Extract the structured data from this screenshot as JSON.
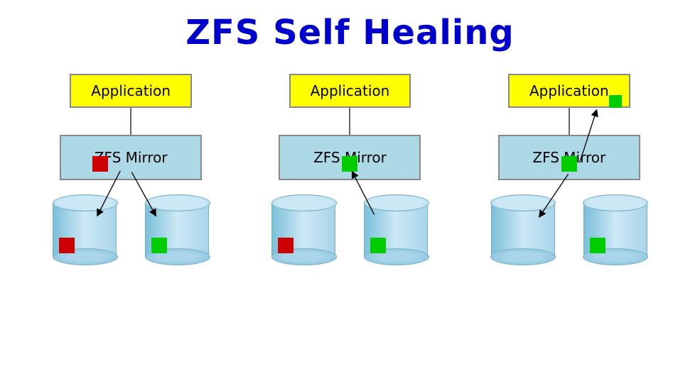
{
  "title": "ZFS Self Healing",
  "diagrams": [
    {
      "id": "diagram-1",
      "app_label": "Application",
      "mirror_label": "ZFS Mirror",
      "mirror_indicator": "red",
      "cylinders": [
        {
          "indicator": "red",
          "position": "left"
        },
        {
          "indicator": "green",
          "position": "right"
        }
      ],
      "arrow_from_mirror_to_left_cyl": true,
      "arrow_from_mirror_to_right_cyl": true
    },
    {
      "id": "diagram-2",
      "app_label": "Application",
      "mirror_label": "ZFS Mirror",
      "mirror_indicator": "green",
      "cylinders": [
        {
          "indicator": "red",
          "position": "left"
        },
        {
          "indicator": "green",
          "position": "right"
        }
      ],
      "arrow_from_right_cyl_to_mirror": true
    },
    {
      "id": "diagram-3",
      "app_label": "Application",
      "mirror_label": "ZFS Mirror",
      "mirror_indicator": "green",
      "app_indicator": "green",
      "cylinders": [
        {
          "indicator": "none",
          "position": "left"
        },
        {
          "indicator": "green",
          "position": "right"
        }
      ],
      "arrow_from_mirror_to_left_cyl": true,
      "arrow_from_mirror_to_app": true
    }
  ]
}
